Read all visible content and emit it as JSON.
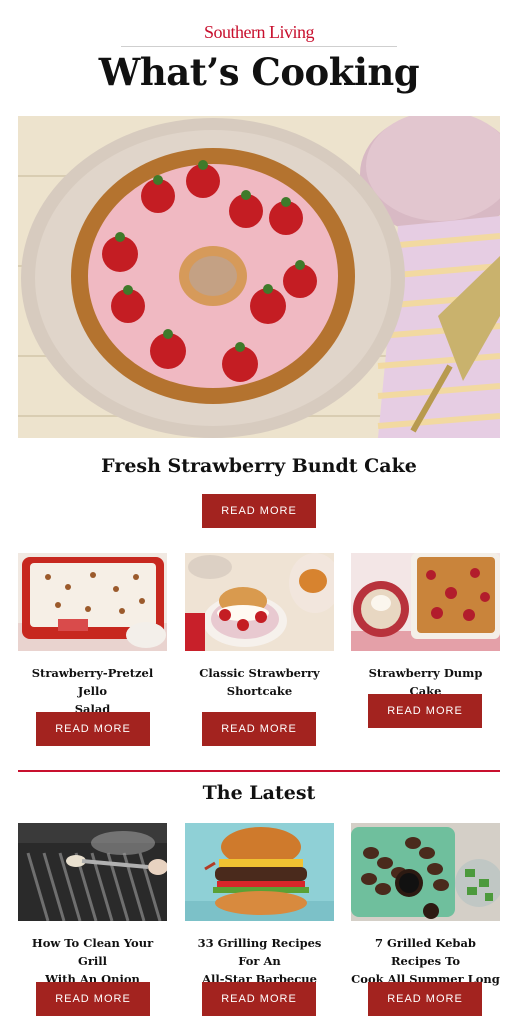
{
  "header": {
    "brand": "Southern Living",
    "title": "What’s Cooking"
  },
  "hero": {
    "title": "Fresh Strawberry Bundt Cake",
    "button_label": "READ MORE"
  },
  "featured": [
    {
      "title_line1": "Strawberry-Pretzel Jello",
      "title_line2": "Salad",
      "button_label": "READ MORE"
    },
    {
      "title_line1": "Classic Strawberry",
      "title_line2": "Shortcake",
      "button_label": "READ MORE"
    },
    {
      "title_line1": "Strawberry Dump Cake",
      "title_line2": "",
      "button_label": "READ MORE"
    }
  ],
  "latest": {
    "heading": "The Latest",
    "items": [
      {
        "title_line1": "How To Clean Your Grill",
        "title_line2": "With An Onion",
        "button_label": "READ MORE"
      },
      {
        "title_line1": "33 Grilling Recipes For An",
        "title_line2": "All-Star Barbecue",
        "button_label": "READ MORE"
      },
      {
        "title_line1": "7 Grilled Kebab Recipes To",
        "title_line2": "Cook All Summer Long",
        "button_label": "READ MORE"
      }
    ]
  },
  "colors": {
    "brand_red": "#c8102e",
    "button_red": "#a3231f"
  }
}
